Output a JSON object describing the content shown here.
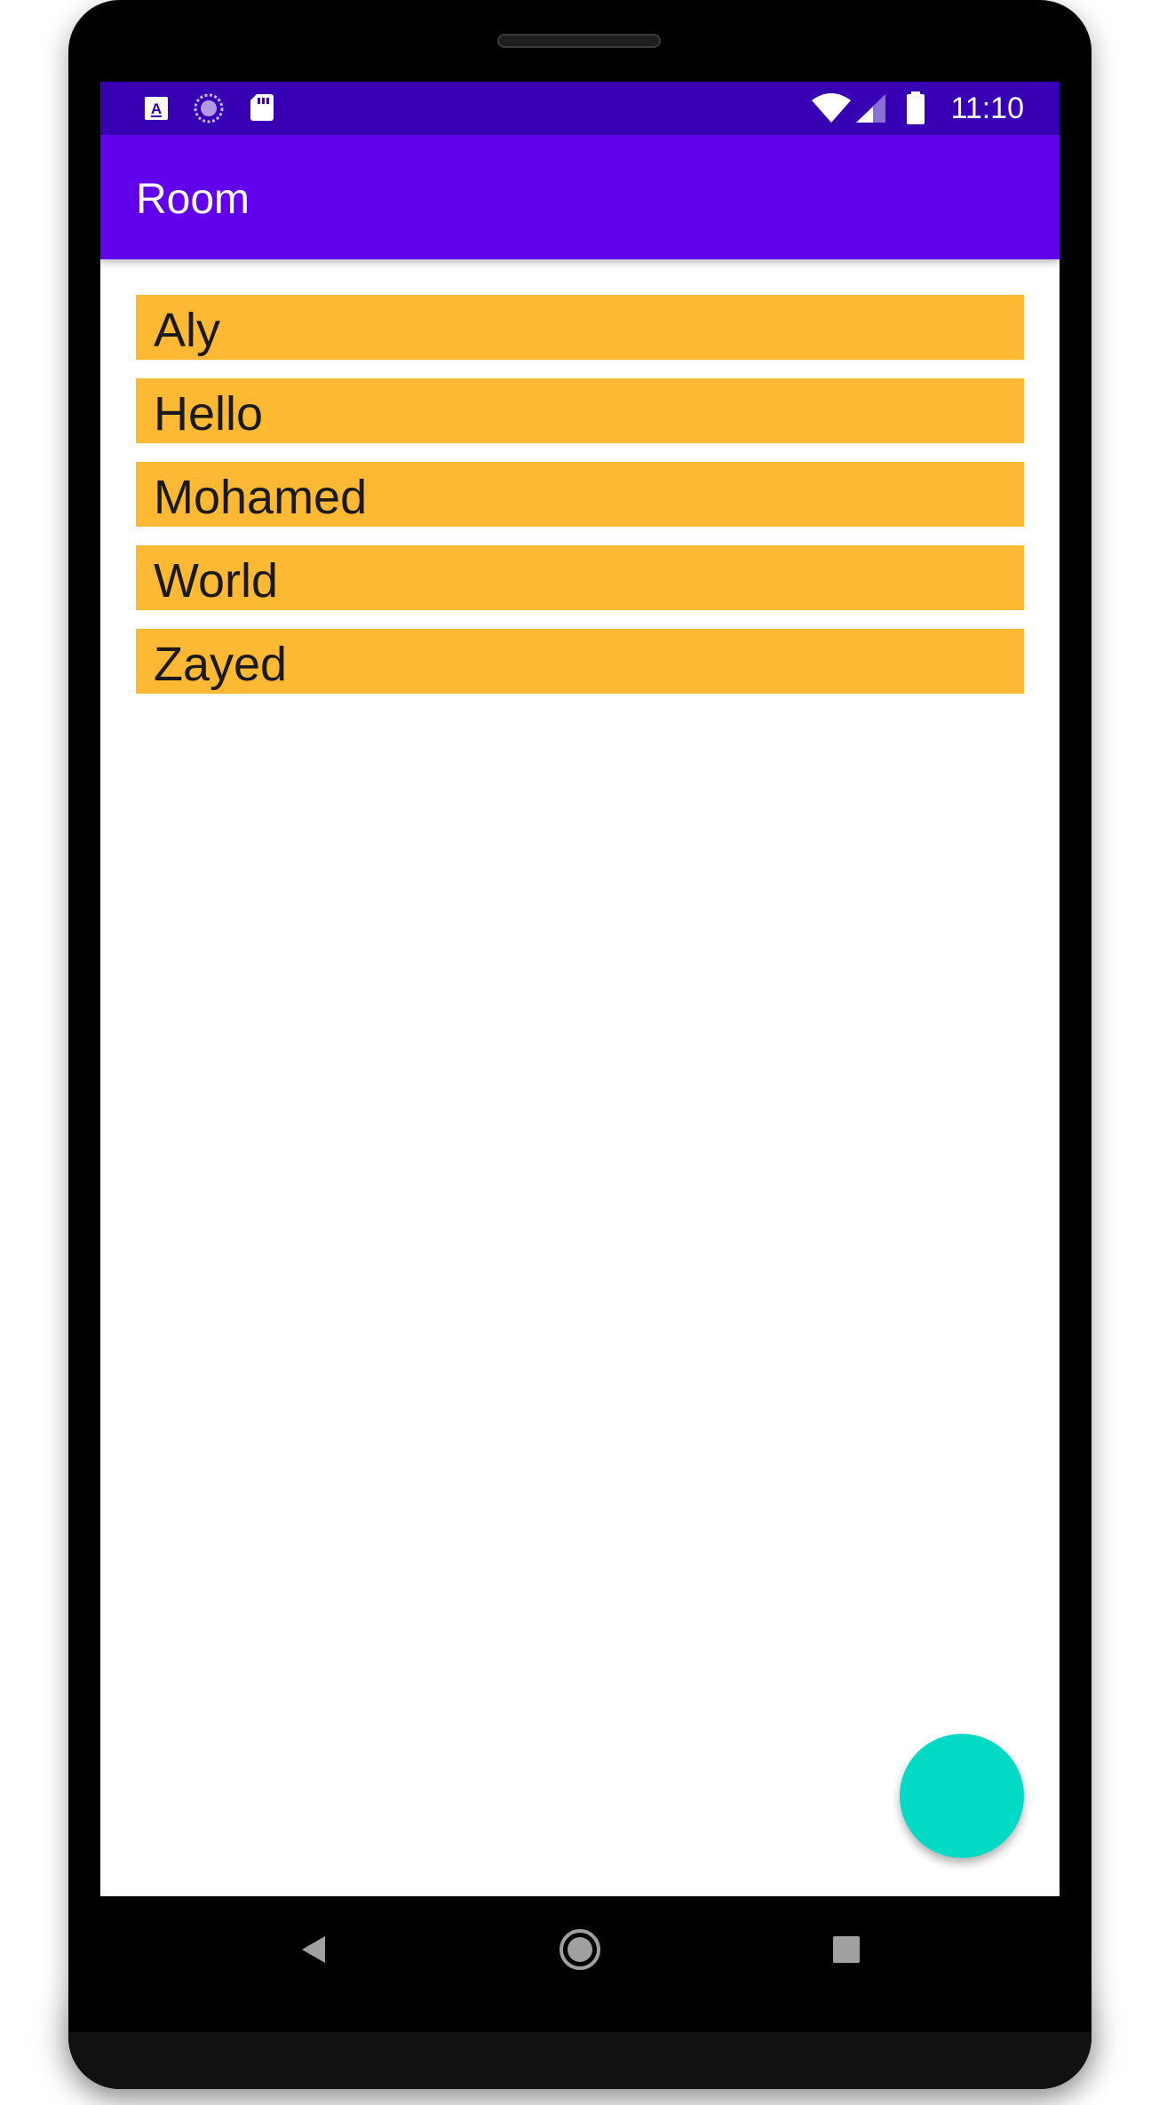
{
  "status_bar": {
    "time": "11:10",
    "left_icons": [
      "font-download-icon",
      "sync-progress-icon",
      "sd-card-icon"
    ],
    "right_icons": [
      "wifi-icon",
      "cell-signal-icon",
      "battery-icon"
    ]
  },
  "app_bar": {
    "title": "Room"
  },
  "words": [
    "Aly",
    "Hello",
    "Mohamed",
    "World",
    "Zayed"
  ],
  "fab": {
    "icon": "none"
  },
  "nav_bar": {
    "buttons": [
      "back-icon",
      "home-icon",
      "recents-icon"
    ]
  },
  "colors": {
    "status_bar": "#3700b3",
    "app_bar": "#6200ee",
    "list_item_background": "#fdb834",
    "fab": "#03dac5"
  }
}
